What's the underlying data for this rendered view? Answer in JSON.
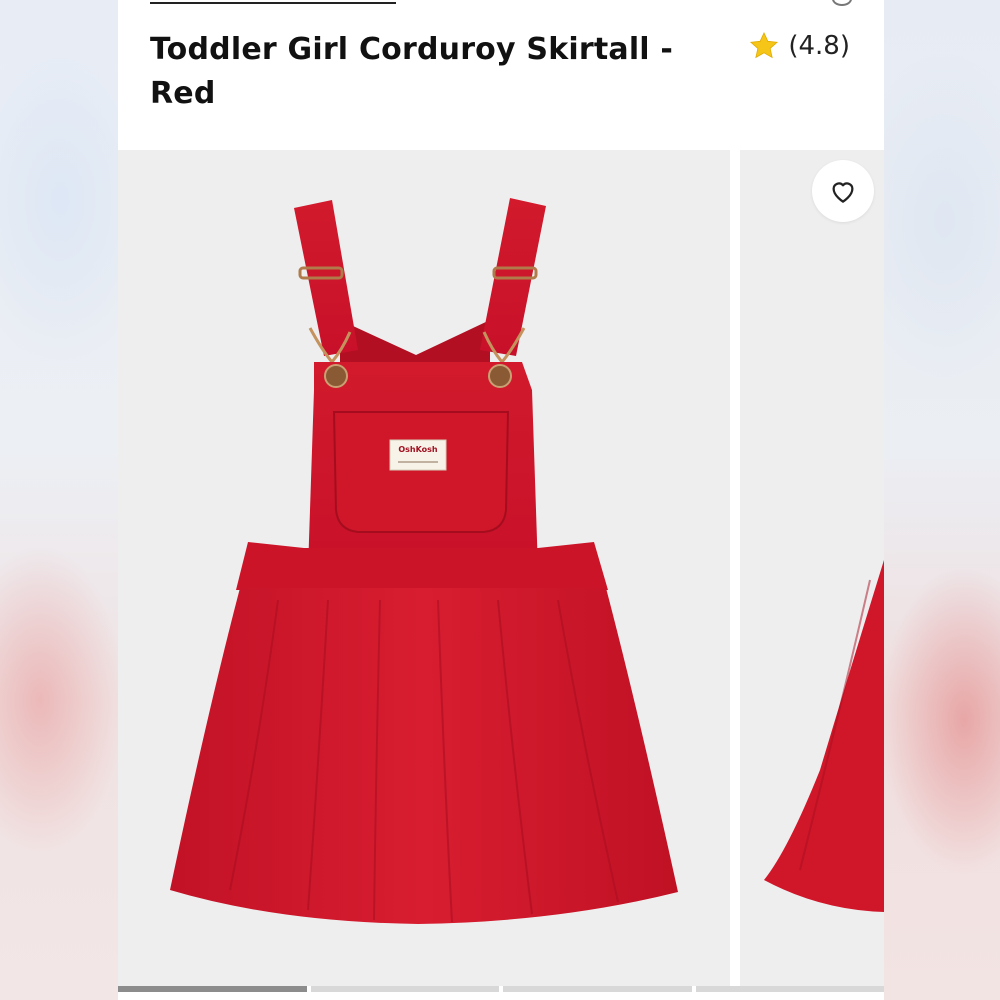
{
  "product": {
    "title": "Toddler Girl Corduroy Skirtall - Red",
    "rating_text": "(4.8)",
    "rating_value": 4.8
  },
  "icons": {
    "rating": "star-icon",
    "favorite": "heart-outline-icon"
  },
  "gallery": {
    "slide_count": 4,
    "active_slide": 1,
    "label_brand": "OshKosh"
  },
  "colors": {
    "accent_star": "#f5c518",
    "product_red": "#d0152a"
  }
}
